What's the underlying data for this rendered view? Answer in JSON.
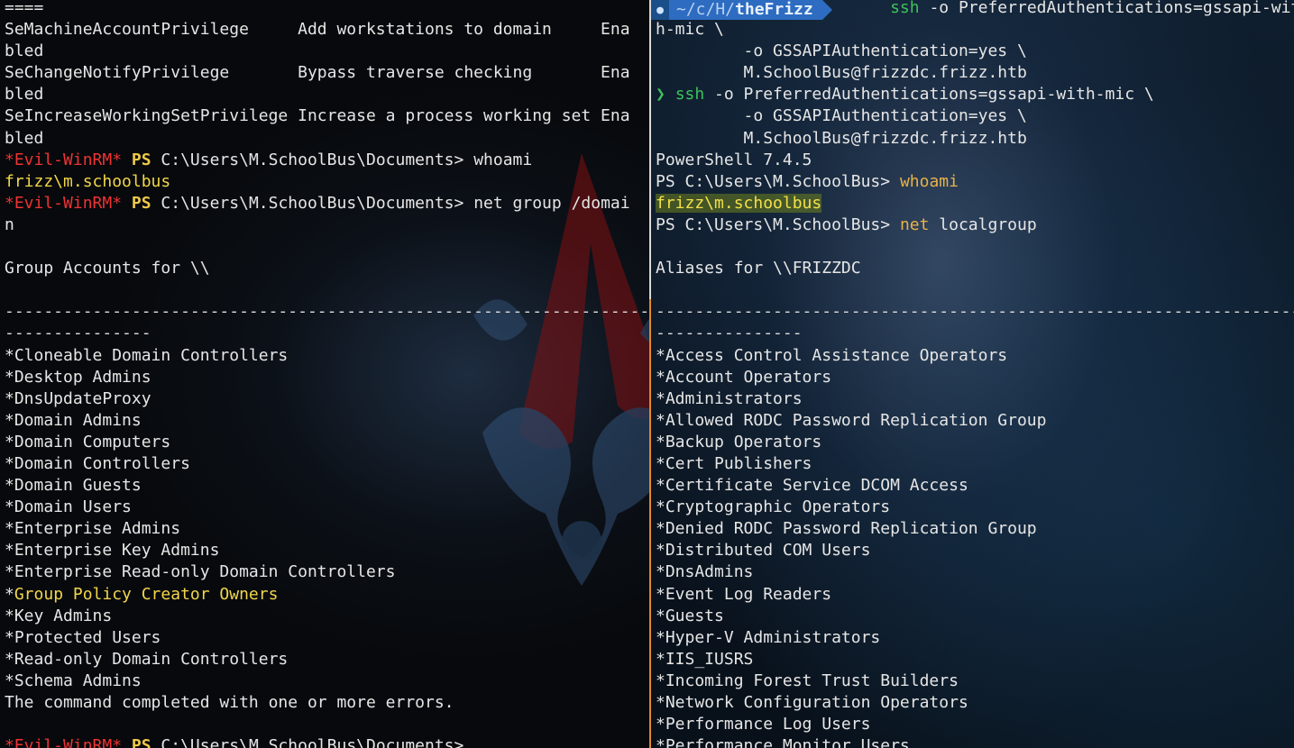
{
  "left_pane": {
    "lines": [
      [
        {
          "t": "===="
        }
      ],
      [
        {
          "t": "SeMachineAccountPrivilege     Add workstations to domain     Ena"
        }
      ],
      [
        {
          "t": "bled"
        }
      ],
      [
        {
          "t": "SeChangeNotifyPrivilege       Bypass traverse checking       Ena"
        }
      ],
      [
        {
          "t": "bled"
        }
      ],
      [
        {
          "t": "SeIncreaseWorkingSetPrivilege Increase a process working set Ena"
        }
      ],
      [
        {
          "t": "bled"
        }
      ],
      [
        {
          "t": "*Evil-WinRM*",
          "c": "red"
        },
        {
          "t": " "
        },
        {
          "t": "PS",
          "c": "yel"
        },
        {
          "t": " C:\\Users\\M.SchoolBus\\Documents> whoami"
        }
      ],
      [
        {
          "t": "frizz\\m.schoolbus",
          "c": "hl"
        }
      ],
      [
        {
          "t": "*Evil-WinRM*",
          "c": "red"
        },
        {
          "t": " "
        },
        {
          "t": "PS",
          "c": "yel"
        },
        {
          "t": " C:\\Users\\M.SchoolBus\\Documents> net group /domai"
        }
      ],
      [
        {
          "t": "n"
        }
      ],
      [
        {
          "t": ""
        }
      ],
      [
        {
          "t": "Group Accounts for \\\\"
        }
      ],
      [
        {
          "t": ""
        }
      ],
      [
        {
          "t": "-------------------------------------------------------------------------------",
          "c": "dash"
        }
      ],
      [
        {
          "t": "---------------",
          "c": "dash"
        }
      ],
      [
        {
          "t": "*Cloneable Domain Controllers"
        }
      ],
      [
        {
          "t": "*Desktop Admins"
        }
      ],
      [
        {
          "t": "*DnsUpdateProxy"
        }
      ],
      [
        {
          "t": "*Domain Admins"
        }
      ],
      [
        {
          "t": "*Domain Computers"
        }
      ],
      [
        {
          "t": "*Domain Controllers"
        }
      ],
      [
        {
          "t": "*Domain Guests"
        }
      ],
      [
        {
          "t": "*Domain Users"
        }
      ],
      [
        {
          "t": "*Enterprise Admins"
        }
      ],
      [
        {
          "t": "*Enterprise Key Admins"
        }
      ],
      [
        {
          "t": "*Enterprise Read-only Domain Controllers"
        }
      ],
      [
        {
          "t": "*"
        },
        {
          "t": "Group Policy Creator Owners",
          "c": "hl"
        }
      ],
      [
        {
          "t": "*Key Admins"
        }
      ],
      [
        {
          "t": "*Protected Users"
        }
      ],
      [
        {
          "t": "*Read-only Domain Controllers"
        }
      ],
      [
        {
          "t": "*Schema Admins"
        }
      ],
      [
        {
          "t": "The command completed with one or more errors."
        }
      ],
      [
        {
          "t": ""
        }
      ],
      [
        {
          "t": "*Evil-WinRM*",
          "c": "red"
        },
        {
          "t": " "
        },
        {
          "t": "PS",
          "c": "yel"
        },
        {
          "t": " C:\\Users\\M.SchoolBus\\Documents>"
        }
      ]
    ]
  },
  "right_pane": {
    "prompt": {
      "path_dim": "~/c/H/",
      "path_bold": "theFrizz"
    },
    "lines": [
      [
        {
          "t": "                        "
        },
        {
          "t": "ssh",
          "c": "grn"
        },
        {
          "t": " -o PreferredAuthentications=gssapi-wit"
        }
      ],
      [
        {
          "t": "h-mic \\"
        }
      ],
      [
        {
          "t": "         -o GSSAPIAuthentication=yes \\"
        }
      ],
      [
        {
          "t": "         M.SchoolBus@frizzdc.frizz.htb"
        }
      ],
      [
        {
          "t": "❯ ",
          "c": "grn"
        },
        {
          "t": "ssh",
          "c": "grn"
        },
        {
          "t": " -o PreferredAuthentications=gssapi-with-mic \\"
        }
      ],
      [
        {
          "t": "         -o GSSAPIAuthentication=yes \\"
        }
      ],
      [
        {
          "t": "         M.SchoolBus@frizzdc.frizz.htb"
        }
      ],
      [
        {
          "t": "PowerShell 7.4.5"
        }
      ],
      [
        {
          "t": "PS C:\\Users\\M.SchoolBus> "
        },
        {
          "t": "whoami",
          "c": "org"
        }
      ],
      [
        {
          "t": "frizz\\m.schoolbus",
          "c": "hl-bg"
        }
      ],
      [
        {
          "t": "PS C:\\Users\\M.SchoolBus> "
        },
        {
          "t": "net",
          "c": "org"
        },
        {
          "t": " localgroup"
        }
      ],
      [
        {
          "t": ""
        }
      ],
      [
        {
          "t": "Aliases for \\\\FRIZZDC"
        }
      ],
      [
        {
          "t": ""
        }
      ],
      [
        {
          "t": "-------------------------------------------------------------------------------",
          "c": "dash"
        }
      ],
      [
        {
          "t": "---------------",
          "c": "dash"
        }
      ],
      [
        {
          "t": "*Access Control Assistance Operators"
        }
      ],
      [
        {
          "t": "*Account Operators"
        }
      ],
      [
        {
          "t": "*Administrators"
        }
      ],
      [
        {
          "t": "*Allowed RODC Password Replication Group"
        }
      ],
      [
        {
          "t": "*Backup Operators"
        }
      ],
      [
        {
          "t": "*Cert Publishers"
        }
      ],
      [
        {
          "t": "*Certificate Service DCOM Access"
        }
      ],
      [
        {
          "t": "*Cryptographic Operators"
        }
      ],
      [
        {
          "t": "*Denied RODC Password Replication Group"
        }
      ],
      [
        {
          "t": "*Distributed COM Users"
        }
      ],
      [
        {
          "t": "*DnsAdmins"
        }
      ],
      [
        {
          "t": "*Event Log Readers"
        }
      ],
      [
        {
          "t": "*Guests"
        }
      ],
      [
        {
          "t": "*Hyper-V Administrators"
        }
      ],
      [
        {
          "t": "*IIS_IUSRS"
        }
      ],
      [
        {
          "t": "*Incoming Forest Trust Builders"
        }
      ],
      [
        {
          "t": "*Network Configuration Operators"
        }
      ],
      [
        {
          "t": "*Performance Log Users"
        }
      ],
      [
        {
          "t": "*Performance Monitor Users"
        }
      ]
    ]
  },
  "colors": {
    "prompt_red": "#ee3333",
    "ps_yellow": "#f0c94a",
    "cmd_green": "#3ec15a",
    "cmd_orange": "#e8b24a",
    "divider_orange": "#e08a2c"
  }
}
